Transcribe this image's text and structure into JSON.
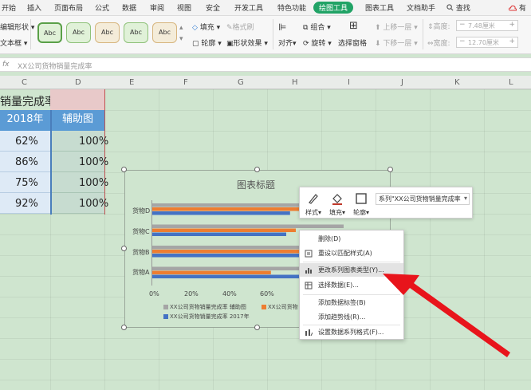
{
  "menu": {
    "tabs": [
      {
        "label": "开始",
        "active": false
      },
      {
        "label": "插入",
        "active": false
      },
      {
        "label": "页面布局",
        "active": false
      },
      {
        "label": "公式",
        "active": false
      },
      {
        "label": "数据",
        "active": false
      },
      {
        "label": "审阅",
        "active": false
      },
      {
        "label": "视图",
        "active": false
      },
      {
        "label": "安全",
        "active": false
      },
      {
        "label": "开发工具",
        "active": false
      },
      {
        "label": "特色功能",
        "active": false
      },
      {
        "label": "绘图工具",
        "active": true
      },
      {
        "label": "图表工具",
        "active": false
      },
      {
        "label": "文档助手",
        "active": false
      }
    ],
    "search_label": "查找",
    "cloud_label": "有",
    "accent_color": "#21a366"
  },
  "ribbon": {
    "left_items": [
      "编辑形状",
      "文本框"
    ],
    "style_label": "Abc",
    "fill_label": "填充",
    "format_painter_label": "格式刷",
    "outline_label": "轮廓",
    "shape_effect_label": "形状效果",
    "align_label": "对齐",
    "group_label": "组合",
    "rotate_label": "旋转",
    "selection_pane_label": "选择窗格",
    "bring_forward_label": "上移一层",
    "send_backward_label": "下移一层",
    "height_label": "高度:",
    "height_value": "7.48厘米",
    "width_label": "宽度:",
    "width_value": "12.70厘米"
  },
  "formula_bar": {
    "fx": "fx",
    "content": "XX公司货物销量完成率"
  },
  "columns": [
    "C",
    "D",
    "E",
    "F",
    "G",
    "H",
    "I",
    "J",
    "K",
    "L"
  ],
  "sheet": {
    "partial_title": "销量完成率",
    "header_c": "2018年",
    "header_d": "辅助图",
    "rows": [
      {
        "c": "62%",
        "d": "100%"
      },
      {
        "c": "86%",
        "d": "100%"
      },
      {
        "c": "75%",
        "d": "100%"
      },
      {
        "c": "92%",
        "d": "100%"
      }
    ]
  },
  "chart": {
    "title": "图表标题",
    "categories": [
      "货物D",
      "货物C",
      "货物B",
      "货物A"
    ],
    "x_ticks": [
      "0%",
      "20%",
      "40%",
      "60%"
    ],
    "legend": [
      {
        "name": "XX公司货物销量完成率 辅助图",
        "color": "#a5a5a5"
      },
      {
        "name": "XX公司货物",
        "color": "#ed7d31"
      },
      {
        "name": "XX公司货物销量完成率 2017年",
        "color": "#4472c4"
      }
    ]
  },
  "chart_data": {
    "type": "bar",
    "categories": [
      "货物D",
      "货物C",
      "货物B",
      "货物A"
    ],
    "series": [
      {
        "name": "XX公司货物销量完成率 辅助图",
        "values": [
          100,
          100,
          100,
          100
        ],
        "color": "#a5a5a5"
      },
      {
        "name": "XX公司货物",
        "values": [
          92,
          75,
          86,
          62
        ],
        "color": "#ed7d31"
      },
      {
        "name": "XX公司货物销量完成率 2017年",
        "values": [
          72,
          70,
          80,
          88
        ],
        "color": "#4472c4"
      }
    ],
    "title": "图表标题",
    "xlabel": "",
    "ylabel": "",
    "xlim": [
      0,
      100
    ],
    "x_ticks_visible": [
      "0%",
      "20%",
      "40%",
      "60%"
    ],
    "orientation": "horizontal",
    "grid": false,
    "legend_position": "bottom"
  },
  "mini_toolbar": {
    "style_label": "样式",
    "fill_label": "填充",
    "outline_label": "轮廓",
    "series_select": "系列\"XX公司货物销量完成率"
  },
  "context_menu": {
    "items": [
      {
        "label": "删除(D)",
        "icon": "delete-icon",
        "highlighted": false
      },
      {
        "label": "重设以匹配样式(A)",
        "icon": "reset-style-icon",
        "highlighted": false
      },
      {
        "label": "更改系列图表类型(Y)...",
        "icon": "chart-type-icon",
        "highlighted": true
      },
      {
        "label": "选择数据(E)...",
        "icon": "select-data-icon",
        "highlighted": false
      },
      {
        "label": "添加数据标签(B)",
        "icon": "",
        "highlighted": false
      },
      {
        "label": "添加趋势线(R)...",
        "icon": "",
        "highlighted": false
      },
      {
        "label": "设置数据系列格式(F)...",
        "icon": "format-series-icon",
        "highlighted": false
      }
    ]
  }
}
